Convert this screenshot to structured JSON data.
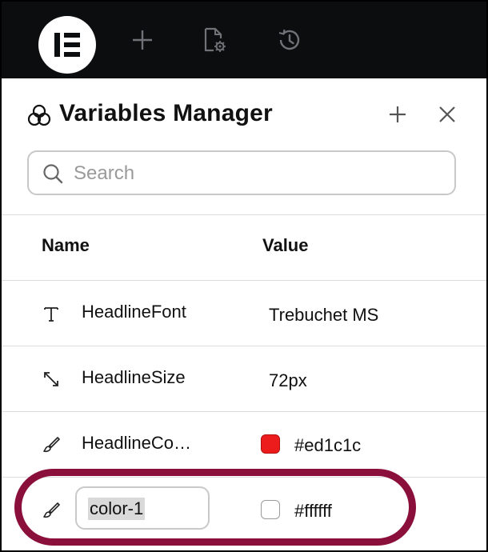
{
  "topbar": {
    "logo_icon": "elementor-logo-icon",
    "add_icon": "plus-icon",
    "page_settings_icon": "page-settings-icon",
    "history_icon": "history-icon"
  },
  "panel": {
    "title": "Variables Manager",
    "title_icon": "variables-icon",
    "add_icon": "plus-icon",
    "close_icon": "close-icon"
  },
  "search": {
    "placeholder": "Search",
    "value": ""
  },
  "table": {
    "columns": {
      "name": "Name",
      "value": "Value"
    },
    "rows": [
      {
        "icon": "text-icon",
        "name": "HeadlineFont",
        "value": "Trebuchet MS"
      },
      {
        "icon": "size-arrows-icon",
        "name": "HeadlineSize",
        "value": "72px"
      },
      {
        "icon": "brush-icon",
        "name": "HeadlineCo…",
        "value": "#ed1c1c",
        "swatch": "#ed1c1c"
      },
      {
        "icon": "brush-icon",
        "name": "color-1",
        "value": "#ffffff",
        "swatch": "#ffffff",
        "editing": true
      }
    ]
  },
  "colors": {
    "topbar": "#0c0d0e",
    "highlight": "#8a0f3a"
  }
}
